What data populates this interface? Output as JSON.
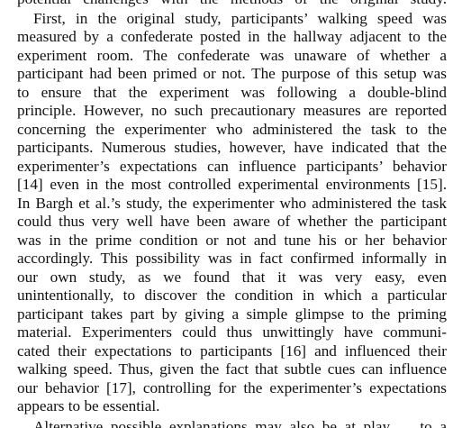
{
  "paragraph": {
    "top_fragment": "potential challenges with the methods of the original study.",
    "lines": [
      "First, in the original study, participants’ walking speed was",
      "measured by a confederate posted in the hallway adjacent to the",
      "experiment room. The confederate was unaware of whether a",
      "participant had been primed or not. The purpose of this setup was",
      "to ensure that the experiment was following a double-blind",
      "principle. However, no such precautionary measures are reported",
      "concerning the experimenter who administered the task to the",
      "participants. Numerous studies, however, have indicated that the",
      "experimenter’s expectations can influence participants’ behavior",
      "[14] even in the most controlled experimental environments [15].",
      "In Bargh et al.’s study, the experimenter who administered the task",
      "could thus very well have been aware of whether the participant",
      "was in the prime condition or not and tune his or her behavior",
      "accordingly. This possibility was in fact confirmed informally in",
      "our own study, as we found that it was very easy, even",
      "unintentionally, to discover the condition in which a particular",
      "participant takes part by giving a simple glimpse to the priming",
      "material. Experimenters could thus unwittingly have communi-",
      "cated their expectations to participants [16] and influenced their",
      "walking speed. Thus, given the fact that subtle cues can influence",
      "our behavior [17], controlling for the experimenter’s expectations",
      "appears to be essential."
    ],
    "bottom_fragment": "Alternative possible explanations may also be at play. ... to a"
  }
}
